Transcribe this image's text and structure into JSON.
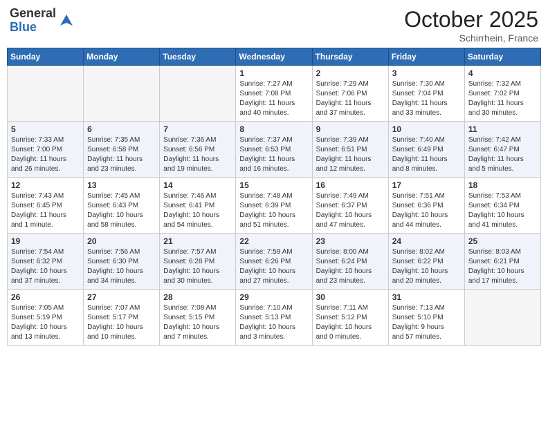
{
  "header": {
    "logo_general": "General",
    "logo_blue": "Blue",
    "month_year": "October 2025",
    "location": "Schirrhein, France"
  },
  "weekdays": [
    "Sunday",
    "Monday",
    "Tuesday",
    "Wednesday",
    "Thursday",
    "Friday",
    "Saturday"
  ],
  "weeks": [
    {
      "alt": false,
      "days": [
        {
          "num": "",
          "info": ""
        },
        {
          "num": "",
          "info": ""
        },
        {
          "num": "",
          "info": ""
        },
        {
          "num": "1",
          "info": "Sunrise: 7:27 AM\nSunset: 7:08 PM\nDaylight: 11 hours\nand 40 minutes."
        },
        {
          "num": "2",
          "info": "Sunrise: 7:29 AM\nSunset: 7:06 PM\nDaylight: 11 hours\nand 37 minutes."
        },
        {
          "num": "3",
          "info": "Sunrise: 7:30 AM\nSunset: 7:04 PM\nDaylight: 11 hours\nand 33 minutes."
        },
        {
          "num": "4",
          "info": "Sunrise: 7:32 AM\nSunset: 7:02 PM\nDaylight: 11 hours\nand 30 minutes."
        }
      ]
    },
    {
      "alt": true,
      "days": [
        {
          "num": "5",
          "info": "Sunrise: 7:33 AM\nSunset: 7:00 PM\nDaylight: 11 hours\nand 26 minutes."
        },
        {
          "num": "6",
          "info": "Sunrise: 7:35 AM\nSunset: 6:58 PM\nDaylight: 11 hours\nand 23 minutes."
        },
        {
          "num": "7",
          "info": "Sunrise: 7:36 AM\nSunset: 6:56 PM\nDaylight: 11 hours\nand 19 minutes."
        },
        {
          "num": "8",
          "info": "Sunrise: 7:37 AM\nSunset: 6:53 PM\nDaylight: 11 hours\nand 16 minutes."
        },
        {
          "num": "9",
          "info": "Sunrise: 7:39 AM\nSunset: 6:51 PM\nDaylight: 11 hours\nand 12 minutes."
        },
        {
          "num": "10",
          "info": "Sunrise: 7:40 AM\nSunset: 6:49 PM\nDaylight: 11 hours\nand 8 minutes."
        },
        {
          "num": "11",
          "info": "Sunrise: 7:42 AM\nSunset: 6:47 PM\nDaylight: 11 hours\nand 5 minutes."
        }
      ]
    },
    {
      "alt": false,
      "days": [
        {
          "num": "12",
          "info": "Sunrise: 7:43 AM\nSunset: 6:45 PM\nDaylight: 11 hours\nand 1 minute."
        },
        {
          "num": "13",
          "info": "Sunrise: 7:45 AM\nSunset: 6:43 PM\nDaylight: 10 hours\nand 58 minutes."
        },
        {
          "num": "14",
          "info": "Sunrise: 7:46 AM\nSunset: 6:41 PM\nDaylight: 10 hours\nand 54 minutes."
        },
        {
          "num": "15",
          "info": "Sunrise: 7:48 AM\nSunset: 6:39 PM\nDaylight: 10 hours\nand 51 minutes."
        },
        {
          "num": "16",
          "info": "Sunrise: 7:49 AM\nSunset: 6:37 PM\nDaylight: 10 hours\nand 47 minutes."
        },
        {
          "num": "17",
          "info": "Sunrise: 7:51 AM\nSunset: 6:36 PM\nDaylight: 10 hours\nand 44 minutes."
        },
        {
          "num": "18",
          "info": "Sunrise: 7:53 AM\nSunset: 6:34 PM\nDaylight: 10 hours\nand 41 minutes."
        }
      ]
    },
    {
      "alt": true,
      "days": [
        {
          "num": "19",
          "info": "Sunrise: 7:54 AM\nSunset: 6:32 PM\nDaylight: 10 hours\nand 37 minutes."
        },
        {
          "num": "20",
          "info": "Sunrise: 7:56 AM\nSunset: 6:30 PM\nDaylight: 10 hours\nand 34 minutes."
        },
        {
          "num": "21",
          "info": "Sunrise: 7:57 AM\nSunset: 6:28 PM\nDaylight: 10 hours\nand 30 minutes."
        },
        {
          "num": "22",
          "info": "Sunrise: 7:59 AM\nSunset: 6:26 PM\nDaylight: 10 hours\nand 27 minutes."
        },
        {
          "num": "23",
          "info": "Sunrise: 8:00 AM\nSunset: 6:24 PM\nDaylight: 10 hours\nand 23 minutes."
        },
        {
          "num": "24",
          "info": "Sunrise: 8:02 AM\nSunset: 6:22 PM\nDaylight: 10 hours\nand 20 minutes."
        },
        {
          "num": "25",
          "info": "Sunrise: 8:03 AM\nSunset: 6:21 PM\nDaylight: 10 hours\nand 17 minutes."
        }
      ]
    },
    {
      "alt": false,
      "days": [
        {
          "num": "26",
          "info": "Sunrise: 7:05 AM\nSunset: 5:19 PM\nDaylight: 10 hours\nand 13 minutes."
        },
        {
          "num": "27",
          "info": "Sunrise: 7:07 AM\nSunset: 5:17 PM\nDaylight: 10 hours\nand 10 minutes."
        },
        {
          "num": "28",
          "info": "Sunrise: 7:08 AM\nSunset: 5:15 PM\nDaylight: 10 hours\nand 7 minutes."
        },
        {
          "num": "29",
          "info": "Sunrise: 7:10 AM\nSunset: 5:13 PM\nDaylight: 10 hours\nand 3 minutes."
        },
        {
          "num": "30",
          "info": "Sunrise: 7:11 AM\nSunset: 5:12 PM\nDaylight: 10 hours\nand 0 minutes."
        },
        {
          "num": "31",
          "info": "Sunrise: 7:13 AM\nSunset: 5:10 PM\nDaylight: 9 hours\nand 57 minutes."
        },
        {
          "num": "",
          "info": ""
        }
      ]
    }
  ]
}
